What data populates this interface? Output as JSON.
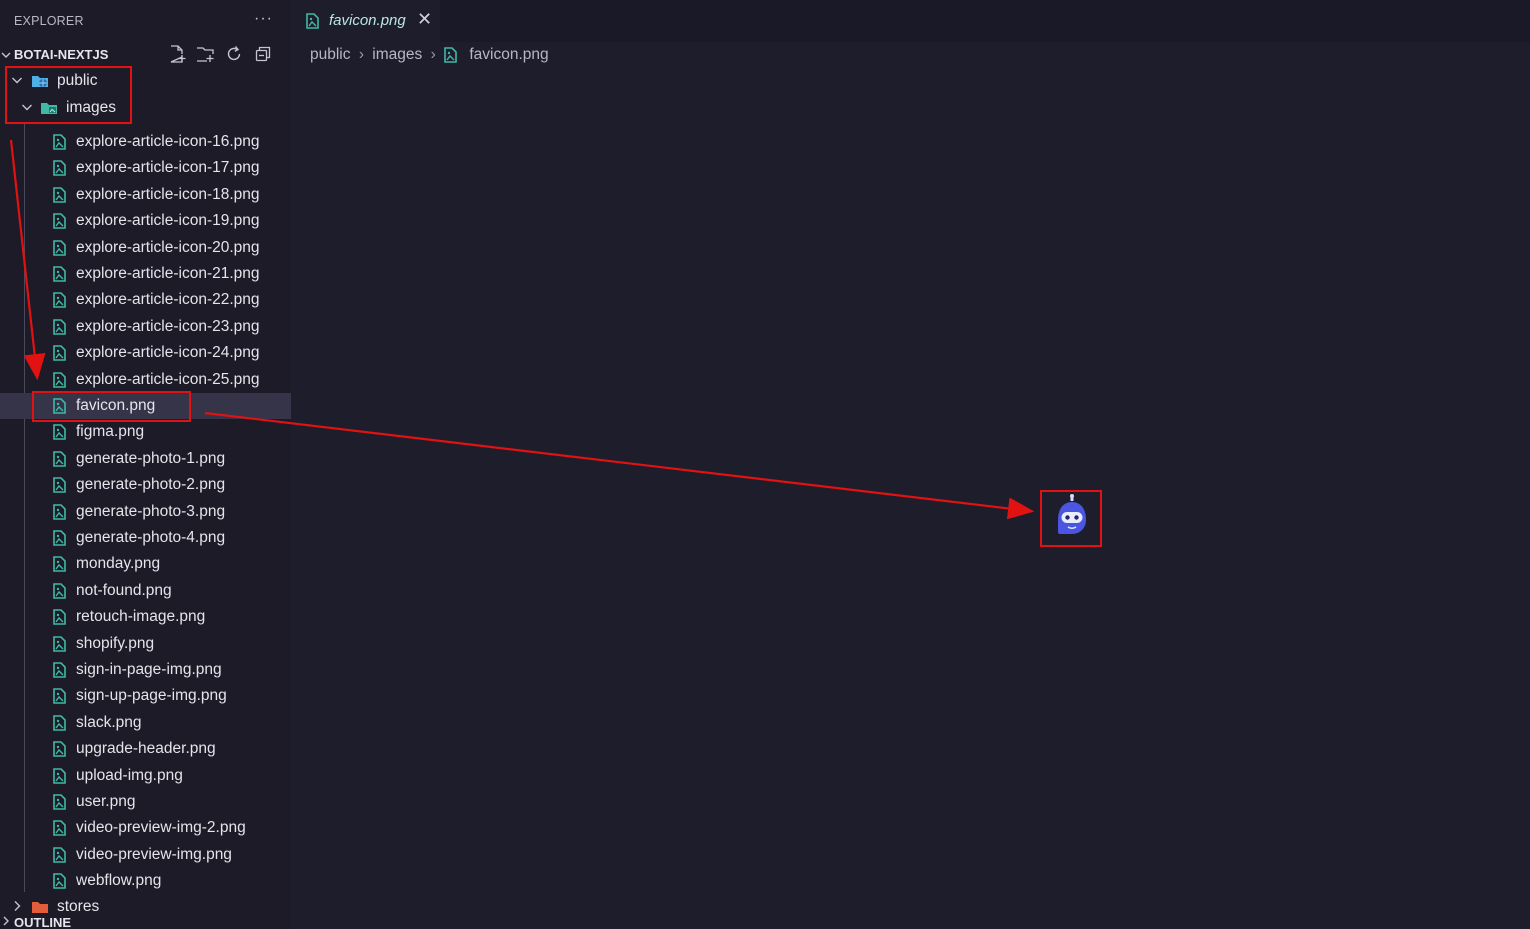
{
  "sidebar": {
    "title": "EXPLORER",
    "more_icon": "ellipsis-icon",
    "project_name": "BOTAI-NEXTJS",
    "toolbar_icons": [
      "new-file-icon",
      "new-folder-icon",
      "refresh-icon",
      "collapse-all-icon"
    ],
    "folders": {
      "public": "public",
      "images": "images",
      "stores": "stores"
    },
    "outline": "OUTLINE",
    "files": [
      "explore-article-icon-16.png",
      "explore-article-icon-17.png",
      "explore-article-icon-18.png",
      "explore-article-icon-19.png",
      "explore-article-icon-20.png",
      "explore-article-icon-21.png",
      "explore-article-icon-22.png",
      "explore-article-icon-23.png",
      "explore-article-icon-24.png",
      "explore-article-icon-25.png",
      "favicon.png",
      "figma.png",
      "generate-photo-1.png",
      "generate-photo-2.png",
      "generate-photo-3.png",
      "generate-photo-4.png",
      "monday.png",
      "not-found.png",
      "retouch-image.png",
      "shopify.png",
      "sign-in-page-img.png",
      "sign-up-page-img.png",
      "slack.png",
      "upgrade-header.png",
      "upload-img.png",
      "user.png",
      "video-preview-img-2.png",
      "video-preview-img.png",
      "webflow.png"
    ],
    "selected_file": "favicon.png"
  },
  "editor": {
    "tab_label": "favicon.png",
    "breadcrumb": [
      "public",
      "images",
      "favicon.png"
    ],
    "preview_icon": "robot-favicon-icon"
  },
  "colors": {
    "annotation": "#e01212",
    "png_icon": "#3fb9a6",
    "folder_public": "#4fb0e6",
    "folder_images": "#3fb9a6",
    "folder_stores": "#e35d3a",
    "robot": "#4a55e0"
  }
}
